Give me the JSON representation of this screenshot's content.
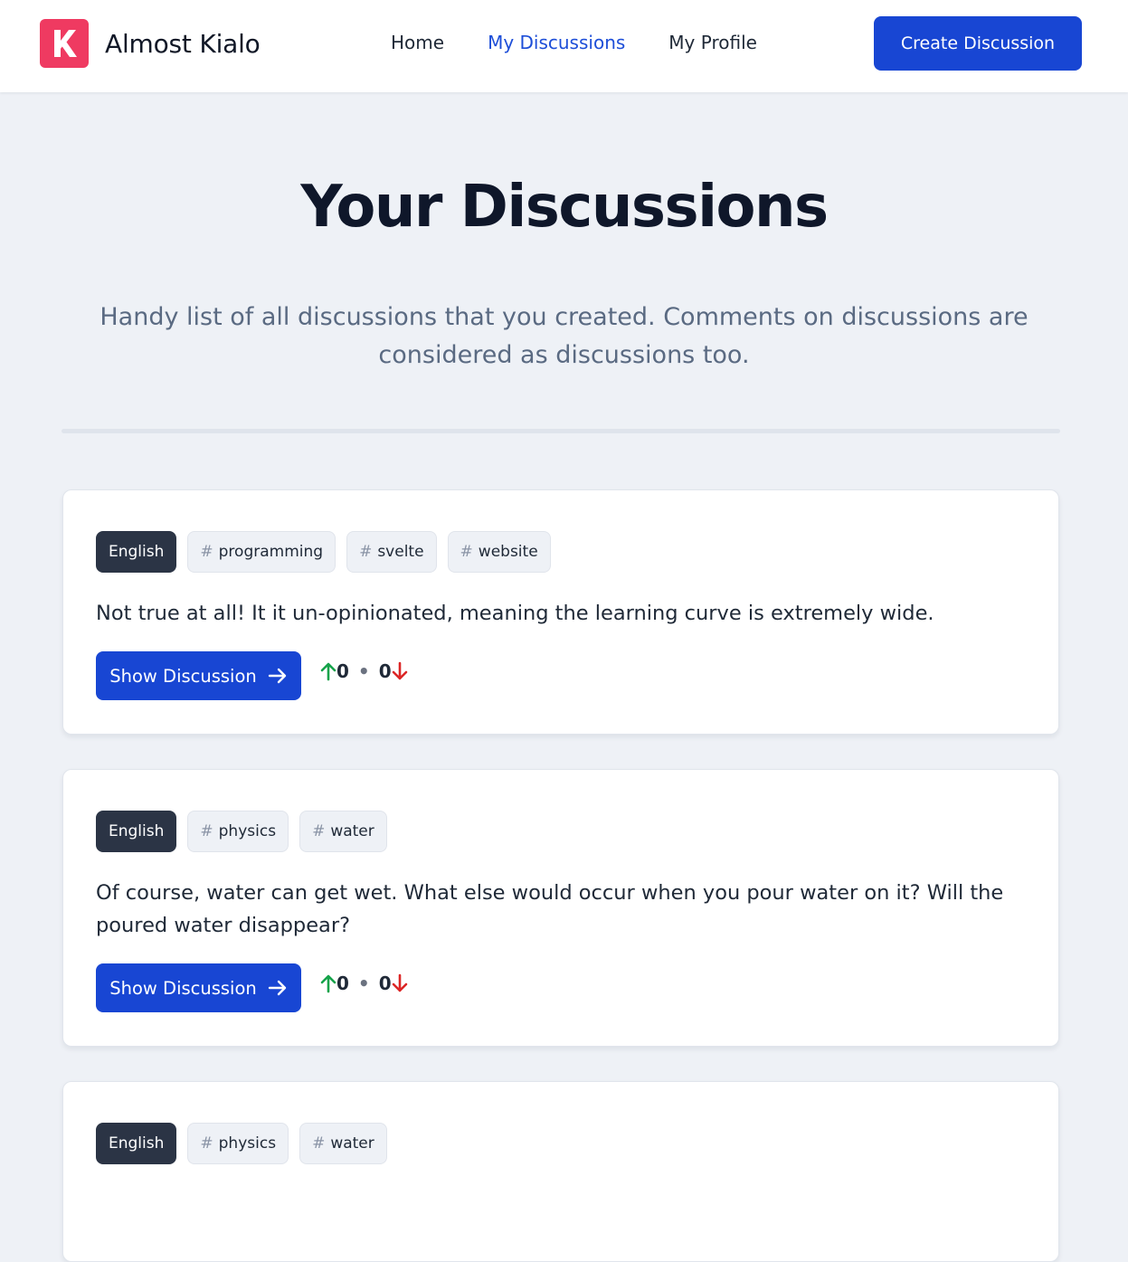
{
  "header": {
    "logo_letter": "K",
    "brand": "Almost Kialo",
    "nav": [
      {
        "label": "Home",
        "active": false
      },
      {
        "label": "My Discussions",
        "active": true
      },
      {
        "label": "My Profile",
        "active": false
      }
    ],
    "create_button": "Create Discussion"
  },
  "page": {
    "title": "Your Discussions",
    "subtitle": "Handy list of all discussions that you created. Comments on discussions are considered as discussions too."
  },
  "colors": {
    "accent": "#1846d3",
    "logo": "#ef3a61",
    "upvote": "#16a34a",
    "downvote": "#dc2626"
  },
  "discussions": [
    {
      "language": "English",
      "tags": [
        "programming",
        "svelte",
        "website"
      ],
      "text": "Not true at all! It it un-opinionated, meaning the learning curve is extremely wide.",
      "button": "Show Discussion",
      "upvotes": "0",
      "downvotes": "0",
      "separator": "•"
    },
    {
      "language": "English",
      "tags": [
        "physics",
        "water"
      ],
      "text": "Of course, water can get wet. What else would occur when you pour water on it? Will the poured water disappear?",
      "button": "Show Discussion",
      "upvotes": "0",
      "downvotes": "0",
      "separator": "•"
    },
    {
      "language": "English",
      "tags": [
        "physics",
        "water"
      ]
    }
  ],
  "tag_prefix": "#"
}
